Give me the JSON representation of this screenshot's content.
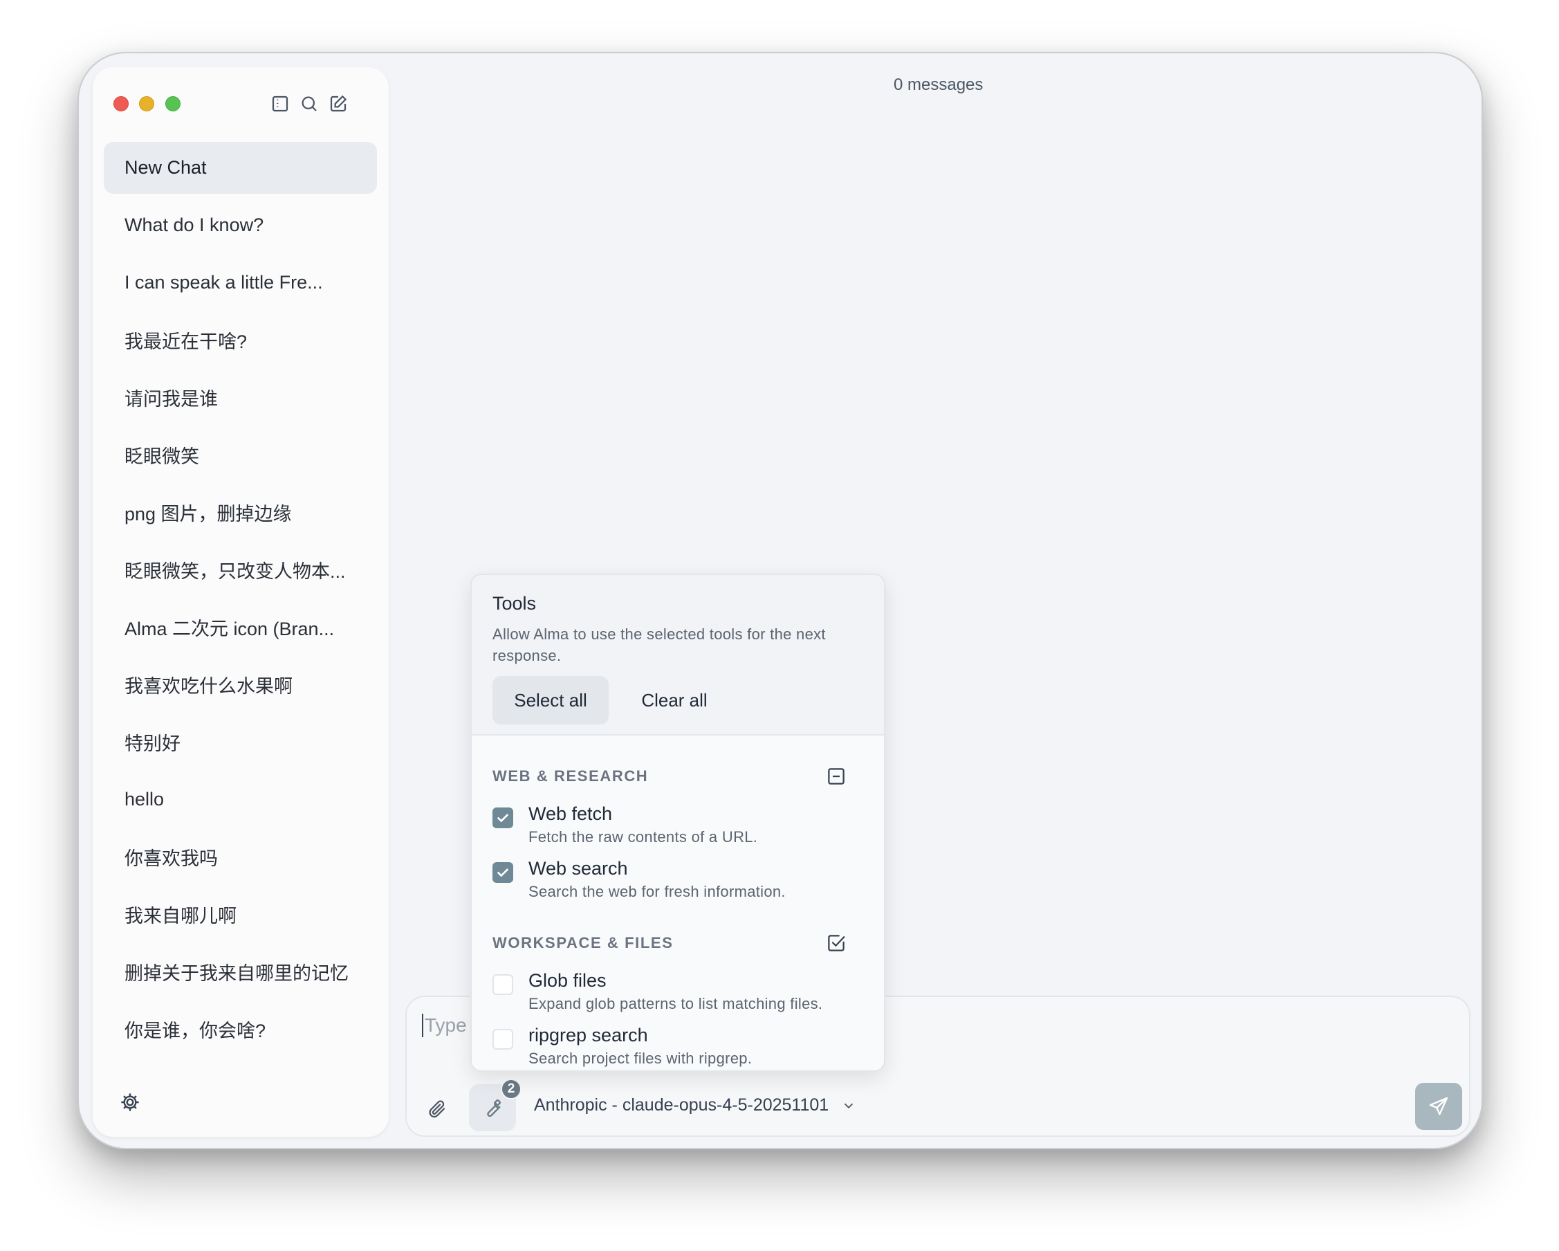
{
  "sidebar": {
    "chats": [
      "New Chat",
      "What do I know?",
      "I can speak a little Fre...",
      "我最近在干啥?",
      "请问我是谁",
      "眨眼微笑",
      "png 图片，删掉边缘",
      "眨眼微笑，只改变人物本...",
      "Alma 二次元 icon (Bran...",
      "我喜欢吃什么水果啊",
      "特别好",
      "hello",
      "你喜欢我吗",
      "我来自哪儿啊",
      "删掉关于我来自哪里的记忆",
      "你是谁，你会啥?"
    ],
    "active_index": 0,
    "icons": [
      "sidebar-toggle-icon",
      "search-icon",
      "compose-icon",
      "gear-icon"
    ]
  },
  "header": {
    "message_count": "0 messages"
  },
  "composer": {
    "placeholder": "Type",
    "tools_count": "2",
    "model": "Anthropic - claude-opus-4-5-20251101"
  },
  "tools_popover": {
    "title": "Tools",
    "description": "Allow Alma to use the selected tools for the next response.",
    "select_all": "Select all",
    "clear_all": "Clear all",
    "sections": [
      {
        "heading": "WEB & RESEARCH",
        "toggle_icon": "minus-square-icon",
        "tools": [
          {
            "name": "Web fetch",
            "description": "Fetch the raw contents of a URL.",
            "checked": true
          },
          {
            "name": "Web search",
            "description": "Search the web for fresh information.",
            "checked": true
          }
        ]
      },
      {
        "heading": "WORKSPACE & FILES",
        "toggle_icon": "check-square-icon",
        "tools": [
          {
            "name": "Glob files",
            "description": "Expand glob patterns to list matching files.",
            "checked": false
          },
          {
            "name": "ripgrep search",
            "description": "Search project files with ripgrep.",
            "checked": false
          }
        ]
      }
    ]
  },
  "colors": {
    "window_bg": "#f2f4f7",
    "sidebar_bg": "#fbfbfc",
    "checkbox_on": "#6f8a96",
    "send_button": "#a9b7bf"
  }
}
